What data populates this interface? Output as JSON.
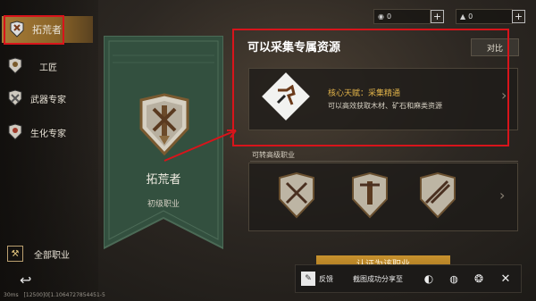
{
  "colors": {
    "accent": "#a67c38",
    "highlight": "#d8141b",
    "gold_text": "#e2b44a",
    "banner": "#3b5a48"
  },
  "top_resources": [
    {
      "icon": "ore-icon",
      "value": "0"
    },
    {
      "icon": "stone-icon",
      "value": "0"
    }
  ],
  "sidebar": {
    "items": [
      {
        "label": "拓荒者",
        "icon": "pioneer-icon",
        "active": true
      },
      {
        "label": "工匠",
        "icon": "craftsman-icon"
      },
      {
        "label": "武器专家",
        "icon": "weapon-expert-icon"
      },
      {
        "label": "生化专家",
        "icon": "biochem-expert-icon"
      }
    ],
    "all_jobs_label": "全部职业"
  },
  "banner": {
    "name": "拓荒者",
    "tier": "初级职业"
  },
  "main": {
    "title": "可以采集专属资源",
    "compare_label": "对比",
    "talent_title": "核心天赋：采集精通",
    "talent_desc": "可以高效获取木材、矿石和麻类资源",
    "advanced_header": "可转高级职业",
    "cta_label": "认证为该职业"
  },
  "share": {
    "feedback_label": "反馈",
    "share_text": "截图成功分享至"
  },
  "status": {
    "ping": "30ms",
    "info": "[12500]0[1.1064727854451-5"
  }
}
